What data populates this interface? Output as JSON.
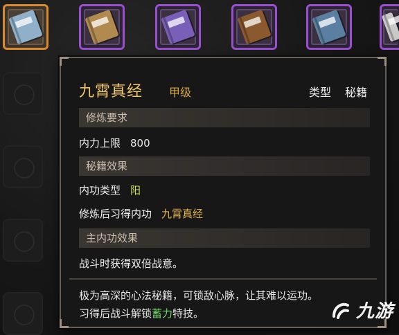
{
  "inventory": {
    "slots": [
      {
        "icon": "scroll-book-icon",
        "color": "#8fb0c8",
        "selected": true
      },
      {
        "icon": "tan-book-icon",
        "color": "#b08a4e",
        "selected": false
      },
      {
        "icon": "purple-book-icon",
        "color": "#7a5fb8",
        "selected": false
      },
      {
        "icon": "brown-book-icon",
        "color": "#8a5a2e",
        "selected": false
      },
      {
        "icon": "blue-book-icon",
        "color": "#5a7fa0",
        "selected": false
      },
      {
        "icon": "white-book-icon",
        "color": "#c8c8c8",
        "selected": false
      }
    ]
  },
  "tooltip": {
    "title": "九霄真经",
    "grade": "甲级",
    "type_label": "类型",
    "type_value": "秘籍",
    "sections": {
      "requirements": "修炼要求",
      "effects": "秘籍效果",
      "main_effect": "主内功效果"
    },
    "requirements": {
      "label": "内力上限",
      "value": "800"
    },
    "effects": {
      "internal_type_label": "内功类型",
      "internal_type_value": "阳",
      "learn_label": "修炼后习得内功",
      "learn_value": "九霄真经"
    },
    "main_effect_text": "战斗时获得双倍战意。",
    "description_line1": "极为高深的心法秘籍，可锁敌心脉，让其难以运功。",
    "description_line2_prefix": "习得后战斗解锁",
    "description_highlight": "蓄力",
    "description_line2_suffix": "特技。"
  },
  "watermark": {
    "text": "九游"
  },
  "colors": {
    "accent_gold": "#f1c56a",
    "grade_gold": "#d6a74a",
    "selected_border": "#d98a2e",
    "purple_border": "#9a4fd0",
    "highlight_green": "#74d36a"
  }
}
